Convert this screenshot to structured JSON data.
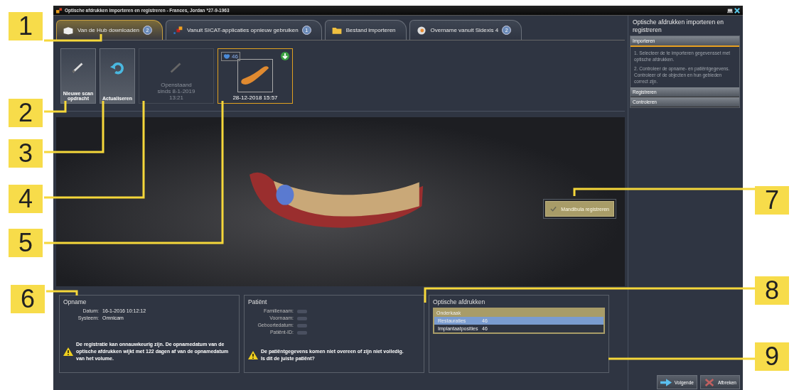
{
  "window": {
    "title": "Optische afdrukken importeren en registreren - Frances, Jordan *27-9-1963"
  },
  "tabs": [
    {
      "label": "Van de Hub downloaden",
      "badge": "2",
      "selected": true
    },
    {
      "label": "Vanuit SICAT-applicaties opnieuw gebruiken",
      "badge": "1",
      "selected": false
    },
    {
      "label": "Bestand importeren",
      "selected": false
    },
    {
      "label": "Overname vanuit Sidexis 4",
      "badge": "2",
      "selected": false
    }
  ],
  "tiles": [
    {
      "kind": "new",
      "label": "Nieuwe scanopdracht"
    },
    {
      "kind": "refresh",
      "label": "Actualiseren"
    },
    {
      "kind": "pending",
      "label": "Openstaand sinds 8-1-2019 13:21"
    },
    {
      "kind": "scan",
      "count": "46",
      "label": "28-12-2018 15:57",
      "selected": true
    }
  ],
  "viewer": {
    "register_button": {
      "label": "Mandibula registreren"
    }
  },
  "recording": {
    "title": "Opname",
    "fields": [
      {
        "label": "Datum:",
        "value": "16-1-2016 10:12:12"
      },
      {
        "label": "Systeem:",
        "value": "Omnicam"
      }
    ],
    "warning": [
      "De registratie kan onnauwkeurig zijn. De opnamedatum van de optische afdrukken wijkt met 122 dagen af van de opnamedatum van het volume."
    ]
  },
  "patient": {
    "title": "Patiënt",
    "fields": [
      {
        "label": "Familienaam:"
      },
      {
        "label": "Voornaam:"
      },
      {
        "label": "Geboortedatum:"
      },
      {
        "label": "Patiënt-ID:"
      }
    ],
    "warning": [
      "De patiëntgegevens komen niet overeen of zijn niet volledig.",
      "Is dit de juiste patiënt?"
    ]
  },
  "impressions": {
    "title": "Optische afdrukken",
    "group": "Onderkaak",
    "rows": [
      {
        "name": "Restauraties",
        "count": "46",
        "selected": true
      },
      {
        "name": "Implantaatposities",
        "count": "46",
        "selected": false
      }
    ]
  },
  "sidebar": {
    "title": "Optische afdrukken importeren en registreren",
    "steps": [
      {
        "label": "Importeren",
        "expanded": true,
        "lines": [
          "1. Selecteer de te importeren gegevensset met optische afdrukken.",
          "2. Controleer de opname- en patiëntgegevens. Controleer of de objecten en hun gebieden correct zijn."
        ]
      },
      {
        "label": "Registreren",
        "expanded": false
      },
      {
        "label": "Controleren",
        "expanded": false
      }
    ]
  },
  "footer": {
    "buttons": [
      {
        "kind": "next",
        "label": "Volgende"
      },
      {
        "kind": "cancel",
        "label": "Afbreken"
      }
    ]
  },
  "callouts": [
    "1",
    "2",
    "3",
    "4",
    "5",
    "6",
    "7",
    "8",
    "9"
  ]
}
